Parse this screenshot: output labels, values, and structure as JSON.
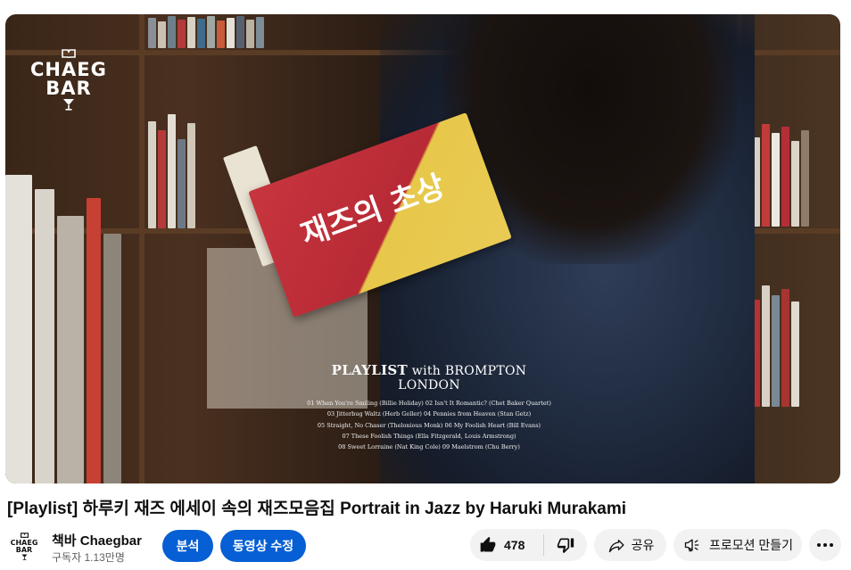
{
  "thumbnail": {
    "logo_line1": "CHAEG",
    "logo_line2": "BAR",
    "book_title": "재즈의 초상",
    "playlist_heading": "PLAYLIST",
    "playlist_with": "with BROMPTON LONDON",
    "tracks": [
      "01 When You're Smiling (Billie Holiday) 02 Isn't It Romantic? (Chet Baker Quartet)",
      "03 Jitterbug Waltz (Herb Geller) 04 Pennies from Heaven (Stan Getz)",
      "05 Straight, No Chaser (Thelonious Monk) 06 My Foolish Heart (Bill Evans)",
      "07 These Foolish Things (Ella Fitzgerald, Louis Armstrong)",
      "08 Sweet Lorraine (Nat King Cole) 09 Maelstrom (Chu Berry)"
    ]
  },
  "video": {
    "title": "[Playlist] 하루키 재즈 에세이 속의 재즈모음집 Portrait in Jazz by Haruki Murakami"
  },
  "channel": {
    "name": "책바 Chaegbar",
    "subscribers": "구독자 1.13만명",
    "avatar_line1": "CHAEG",
    "avatar_line2": "BAR"
  },
  "actions": {
    "analytics_label": "분석",
    "edit_label": "동영상 수정",
    "like_count": "478",
    "share_label": "공유",
    "promote_label": "프로모션 만들기"
  },
  "colors": {
    "primary_button": "#065fd4",
    "pill_background": "#f2f2f2"
  },
  "icons": [
    "thumb-up-icon",
    "thumb-down-icon",
    "share-icon",
    "megaphone-icon",
    "more-icon"
  ]
}
